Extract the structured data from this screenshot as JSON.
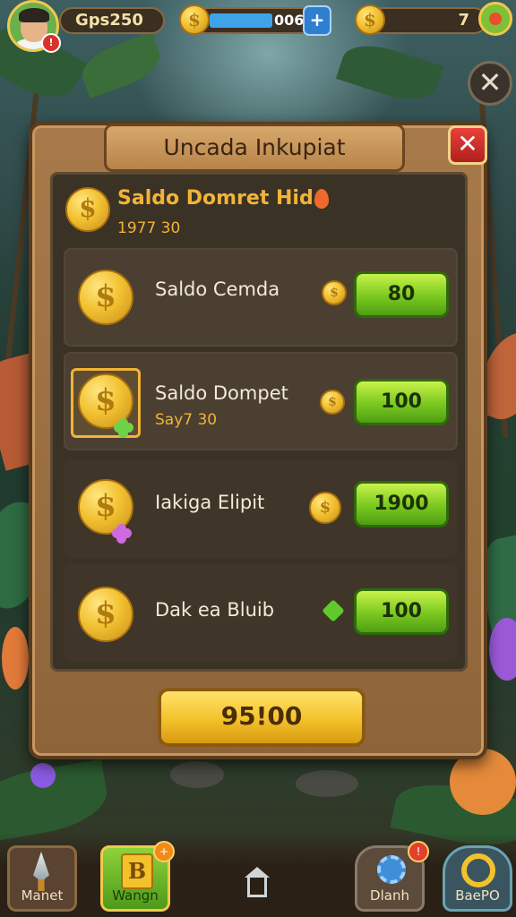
{
  "hud": {
    "coins_value": "Gps250",
    "energy_value": "006",
    "energy_plus": "+",
    "gems_value": "7",
    "coin_symbol": "$",
    "avatar_badge": "!"
  },
  "dialog": {
    "title": "Uncada Inkupiat",
    "close_label": "✕",
    "balance": {
      "title": "Saldo Domret Hid",
      "subtitle": "1977 30"
    },
    "rows": [
      {
        "label": "Saldo Cemda",
        "sub": "",
        "price": "80",
        "icon": "coin"
      },
      {
        "label": "Saldo Dompet",
        "sub": "Say7 30",
        "price": "100",
        "icon": "coin"
      },
      {
        "label": "Iakiga Elipit",
        "sub": "",
        "price": "1900",
        "icon": "coin"
      },
      {
        "label": "Dak ea Bluib",
        "sub": "",
        "price": "100",
        "icon": "gem"
      }
    ],
    "main_button": "95!00"
  },
  "nav": {
    "items": [
      {
        "label": "Manet",
        "icon": "dagger-icon"
      },
      {
        "label": "Wangn",
        "icon": "book-icon"
      },
      {
        "label": "",
        "icon": "home-icon"
      },
      {
        "label": "Dlanh",
        "icon": "cog-icon"
      },
      {
        "label": "BaePO",
        "icon": "ring-icon"
      }
    ],
    "badge_2": "+",
    "badge_4": "!"
  },
  "colors": {
    "accent_gold": "#f2b437",
    "button_green": "#7ac81f",
    "button_yellow": "#f3c12a",
    "close_red": "#d8322a"
  }
}
